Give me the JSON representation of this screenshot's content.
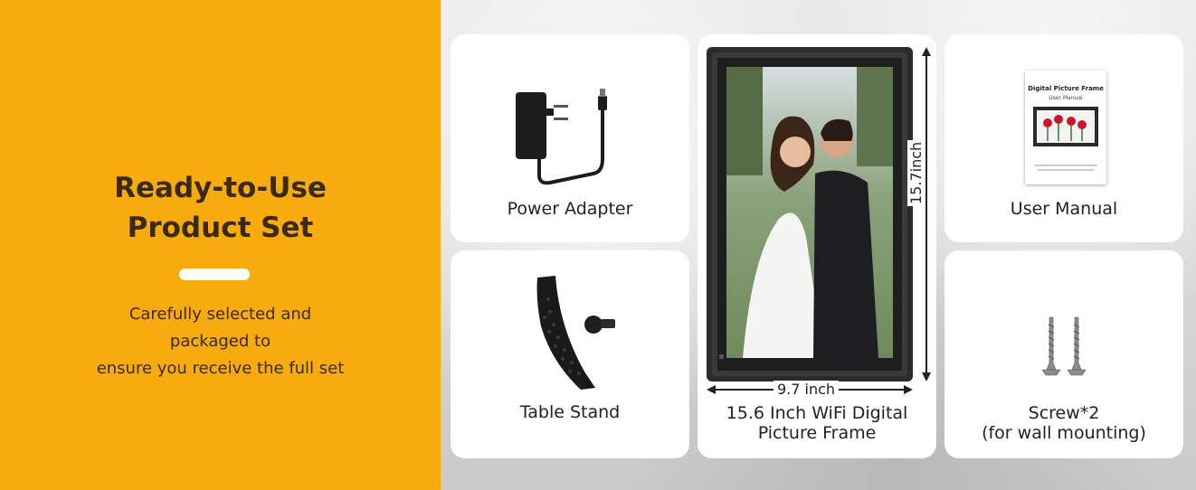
{
  "headline": {
    "line1": "Ready-to-Use",
    "line2": "Product Set"
  },
  "subtitle": {
    "line1": "Carefully selected and",
    "line2": "packaged to",
    "line3": "ensure you receive the full set"
  },
  "items": {
    "power_adapter": "Power Adapter",
    "table_stand": "Table Stand",
    "frame_line1": "15.6 Inch WiFi Digital",
    "frame_line2": "Picture Frame",
    "user_manual": "User Manual",
    "screw_line1": "Screw*2",
    "screw_line2": "(for wall mounting)"
  },
  "dimensions": {
    "height": "15.7inch",
    "width": "9.7 inch"
  },
  "manual_cover": {
    "title": "Digital Picture Frame",
    "subtitle": "User Manual"
  },
  "colors": {
    "accent": "#F7AB0D",
    "text": "#3b2a12",
    "card": "#ffffff"
  },
  "icons": [
    "power-adapter-icon",
    "table-stand-icon",
    "digital-frame-image",
    "user-manual-icon",
    "screws-icon"
  ]
}
